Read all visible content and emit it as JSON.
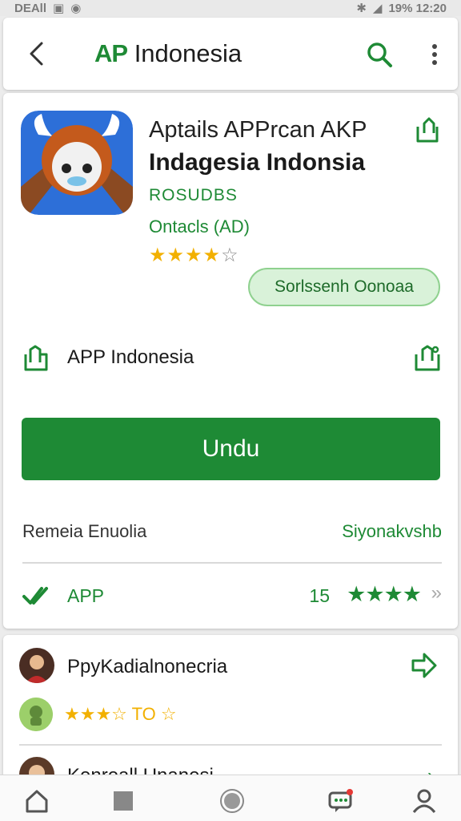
{
  "status_bar": {
    "left_text": "DEAll",
    "right_text": "19% 12:20"
  },
  "app_bar": {
    "title_brand": "AP",
    "title_rest": " Indonesia"
  },
  "app": {
    "name_line1": "Aptails APPrcan AKP",
    "name_line2": "Indagesia Indonsia",
    "developer": "ROSUDBS",
    "category": "Ontacls (AD)",
    "rating_stars_filled": "★★★★",
    "rating_stars_empty": "☆",
    "rating_value": 4,
    "subscribe_label": "Sorlssenh Oonoaa",
    "info_label": "APP Indonesia",
    "install_label": "Undu",
    "meta_left": "Remeia Enuolia",
    "meta_right": "Siyonakvshb",
    "app_row_label": "APP",
    "app_row_count": "15",
    "app_row_stars": "★★★★",
    "app_row_arrow": "»"
  },
  "reviews": [
    {
      "name": "PpyKadialnonecria",
      "stars": "★★★☆",
      "badge_text": "TO ☆"
    },
    {
      "name": "Kenreall Unanesi"
    }
  ],
  "colors": {
    "accent": "#1e8a35",
    "star": "#f2b000",
    "subscribe_bg": "#d9f2d9"
  },
  "icons": {
    "back": "chevron-left-icon",
    "search": "search-icon",
    "more": "more-vertical-icon",
    "share": "share-icon",
    "info": "install-icon",
    "check": "double-check-icon",
    "forward": "forward-icon",
    "home": "home-icon",
    "square": "square-icon",
    "circle": "circle-icon",
    "chat": "chat-icon",
    "profile": "profile-icon"
  }
}
